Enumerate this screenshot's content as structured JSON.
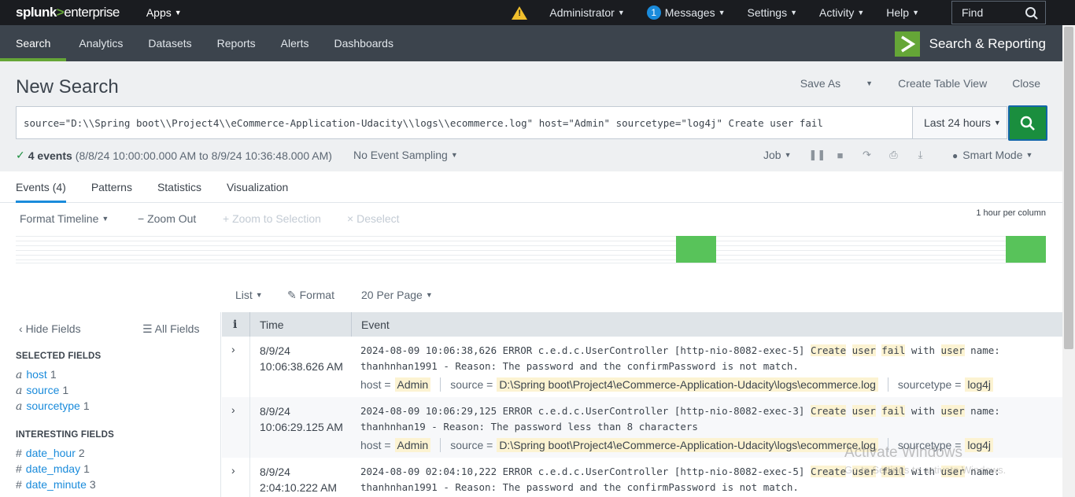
{
  "topbar": {
    "logo_main": "splunk",
    "logo_gt": ">",
    "logo_ent": "enterprise",
    "apps": "Apps",
    "user": "Administrator",
    "messages_count": "1",
    "messages": "Messages",
    "settings": "Settings",
    "activity": "Activity",
    "help": "Help",
    "find": "Find"
  },
  "appnav": {
    "tabs": [
      "Search",
      "Analytics",
      "Datasets",
      "Reports",
      "Alerts",
      "Dashboards"
    ],
    "app_name": "Search & Reporting"
  },
  "search": {
    "title": "New Search",
    "save_as": "Save As",
    "create_table": "Create Table View",
    "close": "Close",
    "query": "source=\"D:\\\\Spring boot\\\\Project4\\\\eCommerce-Application-Udacity\\\\logs\\\\ecommerce.log\" host=\"Admin\" sourcetype=\"log4j\" Create user fail",
    "time_range": "Last 24 hours",
    "events_count": "4 events",
    "events_range": "(8/8/24 10:00:00.000 AM to 8/9/24 10:36:48.000 AM)",
    "sampling": "No Event Sampling",
    "job": "Job",
    "mode": "Smart Mode"
  },
  "results_tabs": [
    "Events (4)",
    "Patterns",
    "Statistics",
    "Visualization"
  ],
  "timeline": {
    "format": "Format Timeline",
    "zoom_out": "Zoom Out",
    "zoom_selection": "Zoom to Selection",
    "deselect": "Deselect",
    "scale": "1 hour per column"
  },
  "list_controls": {
    "list": "List",
    "format": "Format",
    "per_page": "20 Per Page"
  },
  "sidebar": {
    "hide_fields": "Hide Fields",
    "all_fields": "All Fields",
    "selected_heading": "SELECTED FIELDS",
    "selected": [
      {
        "type": "a",
        "name": "host",
        "count": "1"
      },
      {
        "type": "a",
        "name": "source",
        "count": "1"
      },
      {
        "type": "a",
        "name": "sourcetype",
        "count": "1"
      }
    ],
    "interesting_heading": "INTERESTING FIELDS",
    "interesting": [
      {
        "type": "#",
        "name": "date_hour",
        "count": "2"
      },
      {
        "type": "#",
        "name": "date_mday",
        "count": "1"
      },
      {
        "type": "#",
        "name": "date_minute",
        "count": "3"
      }
    ]
  },
  "events": {
    "col_i": "i",
    "col_time": "Time",
    "col_event": "Event",
    "rows": [
      {
        "date": "8/9/24",
        "time": "10:06:38.626 AM",
        "prefix": "2024-08-09 10:06:38,626 ERROR c.e.d.c.UserController [http-nio-8082-exec-5] ",
        "w_create": "Create",
        "w_user": "user",
        "w_fail": "fail",
        "w_with": " with ",
        "w_user2": "user",
        "suffix": " name: thanhnhan1991 - Reason: The password and the confirmPassword is not match.",
        "host": "Admin",
        "source": "D:\\Spring boot\\Project4\\eCommerce-Application-Udacity\\logs\\ecommerce.log",
        "sourcetype": "log4j"
      },
      {
        "date": "8/9/24",
        "time": "10:06:29.125 AM",
        "prefix": "2024-08-09 10:06:29,125 ERROR c.e.d.c.UserController [http-nio-8082-exec-3] ",
        "w_create": "Create",
        "w_user": "user",
        "w_fail": "fail",
        "w_with": " with ",
        "w_user2": "user",
        "suffix": " name: thanhnhan19 - Reason: The password less than 8 characters",
        "host": "Admin",
        "source": "D:\\Spring boot\\Project4\\eCommerce-Application-Udacity\\logs\\ecommerce.log",
        "sourcetype": "log4j"
      },
      {
        "date": "8/9/24",
        "time": "2:04:10.222 AM",
        "prefix": "2024-08-09 02:04:10,222 ERROR c.e.d.c.UserController [http-nio-8082-exec-5] ",
        "w_create": "Create",
        "w_user": "user",
        "w_fail": "fail",
        "w_with": " with ",
        "w_user2": "user",
        "suffix": " name: thanhnhan1991 - Reason: The password and the confirmPassword is not match."
      }
    ],
    "meta_host_label": "host =",
    "meta_source_label": "source =",
    "meta_sourcetype_label": "sourcetype ="
  },
  "watermark": {
    "line1": "Activate Windows",
    "line2": "Go to Settings to activate Windows."
  },
  "colors": {
    "accent_green": "#65a637",
    "search_button": "#1a8e3e",
    "link_blue": "#1a8bdb",
    "highlight": "#fcf3d2",
    "timeline_bar": "#58c35a"
  }
}
